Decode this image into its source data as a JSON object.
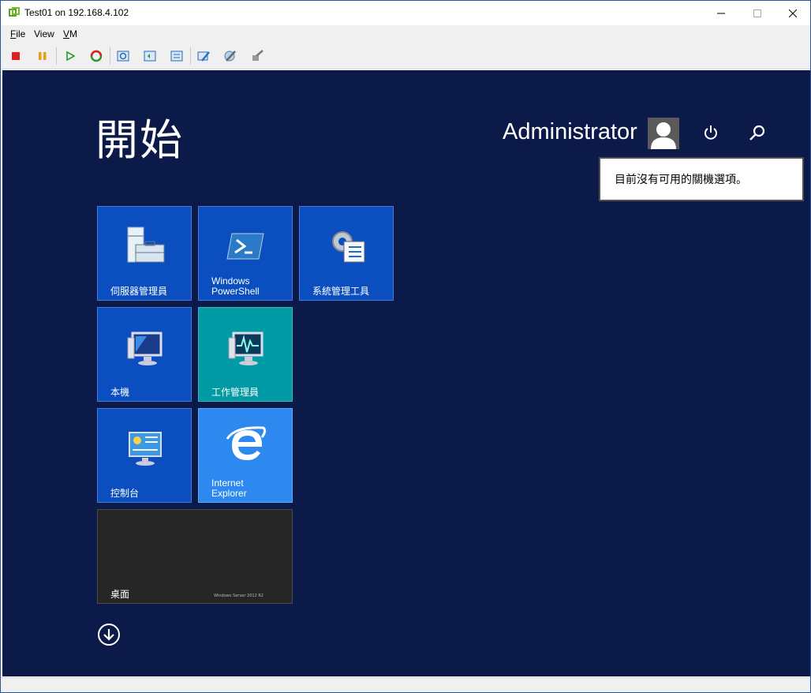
{
  "window": {
    "title": "Test01 on 192.168.4.102",
    "controls": {
      "minimize": "—",
      "maximize": "☐",
      "close": "✕"
    }
  },
  "menubar": {
    "items": [
      {
        "accel": "F",
        "rest": "ile"
      },
      {
        "accel": "",
        "rest": "View"
      },
      {
        "accel": "V",
        "rest": "M"
      }
    ]
  },
  "toolbar": {
    "buttons": [
      "stop-icon",
      "pause-icon",
      "play-icon",
      "reset-icon",
      "snapshot-icon",
      "revert-snapshot-icon",
      "manage-snapshots-icon",
      "edit-settings-icon",
      "install-tools-icon",
      "disconnect-device-icon"
    ]
  },
  "start": {
    "title": "開始",
    "user": "Administrator",
    "power_popup": "目前沒有可用的關機選項。",
    "tiles": [
      {
        "label": "伺服器管理員",
        "icon": "server-manager-icon"
      },
      {
        "label_line1": "Windows",
        "label_line2": "PowerShell",
        "icon": "powershell-icon"
      },
      {
        "label": "系統管理工具",
        "icon": "admin-tools-icon"
      },
      {
        "label": "本機",
        "icon": "this-pc-icon"
      },
      {
        "label": "工作管理員",
        "icon": "task-manager-icon"
      },
      {
        "label": "控制台",
        "icon": "control-panel-icon"
      },
      {
        "label_line1": "Internet",
        "label_line2": "Explorer",
        "icon": "internet-explorer-icon"
      },
      {
        "label": "桌面",
        "watermark": "Windows Server 2012 R2",
        "icon": "desktop-tile"
      }
    ]
  },
  "colors": {
    "start_bg": "#0b1a48",
    "tile_blue": "#0a4ec0",
    "tile_teal": "#009ba4",
    "tile_ie": "#2d89ef",
    "tile_desktop": "#262626"
  }
}
